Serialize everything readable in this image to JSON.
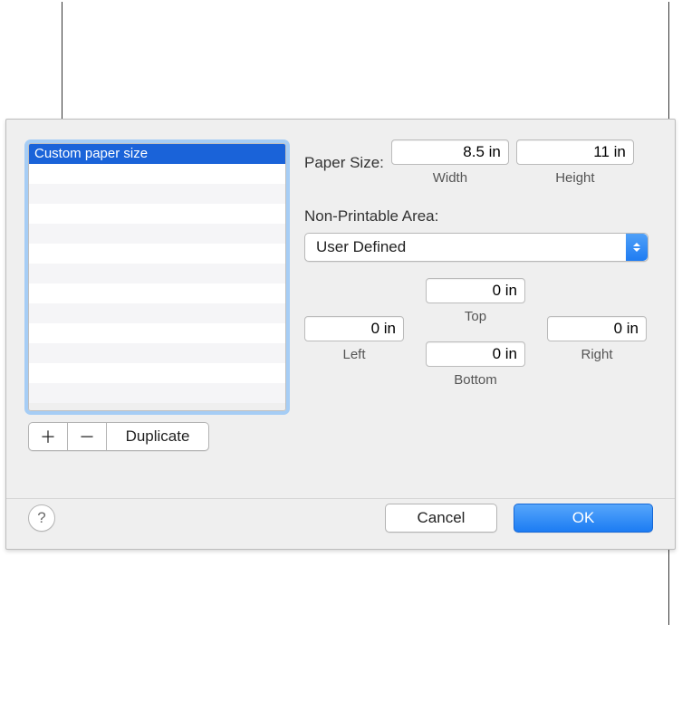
{
  "sidebar": {
    "selected_label": "Custom paper size"
  },
  "toolbar": {
    "plus_label": "＋",
    "minus_label": "－",
    "duplicate_label": "Duplicate"
  },
  "paper_size": {
    "label": "Paper Size:",
    "width_value": "8.5 in",
    "width_sublabel": "Width",
    "height_value": "11 in",
    "height_sublabel": "Height"
  },
  "non_printable": {
    "label": "Non-Printable Area:",
    "popup_value": "User Defined",
    "top_value": "0 in",
    "top_label": "Top",
    "left_value": "0 in",
    "left_label": "Left",
    "right_value": "0 in",
    "right_label": "Right",
    "bottom_value": "0 in",
    "bottom_label": "Bottom"
  },
  "footer": {
    "help_label": "?",
    "cancel_label": "Cancel",
    "ok_label": "OK"
  }
}
